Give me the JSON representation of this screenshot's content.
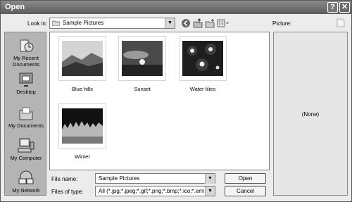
{
  "window": {
    "title": "Open",
    "help": "?",
    "close": "✕"
  },
  "toolbar": {
    "look_in_label": "Look in:",
    "look_in_value": "Sample Pictures",
    "dropdown_glyph": "▼",
    "icons": [
      "back-icon",
      "up-folder-icon",
      "new-folder-icon",
      "views-menu-icon"
    ]
  },
  "places": [
    {
      "label": "My Recent Documents",
      "icon": "recent-documents-icon"
    },
    {
      "label": "Desktop",
      "icon": "desktop-icon"
    },
    {
      "label": "My Documents",
      "icon": "my-documents-icon"
    },
    {
      "label": "My Computer",
      "icon": "my-computer-icon"
    },
    {
      "label": "My Network",
      "icon": "my-network-icon"
    }
  ],
  "files": [
    {
      "name": "Blue hills"
    },
    {
      "name": "Sunset"
    },
    {
      "name": "Water lilies"
    },
    {
      "name": "Winter"
    }
  ],
  "form": {
    "file_name_label": "File name:",
    "file_name_value": "Sample Pictures",
    "file_type_label": "Files of type:",
    "file_type_value": "All (*.jpg;*.jpeg;*.gif;*.png;*.bmp;*.ico;*.emf;*.wmf)",
    "open_label": "Open",
    "cancel_label": "Cancel"
  },
  "preview": {
    "label": "Picture:",
    "value": "(None)"
  }
}
